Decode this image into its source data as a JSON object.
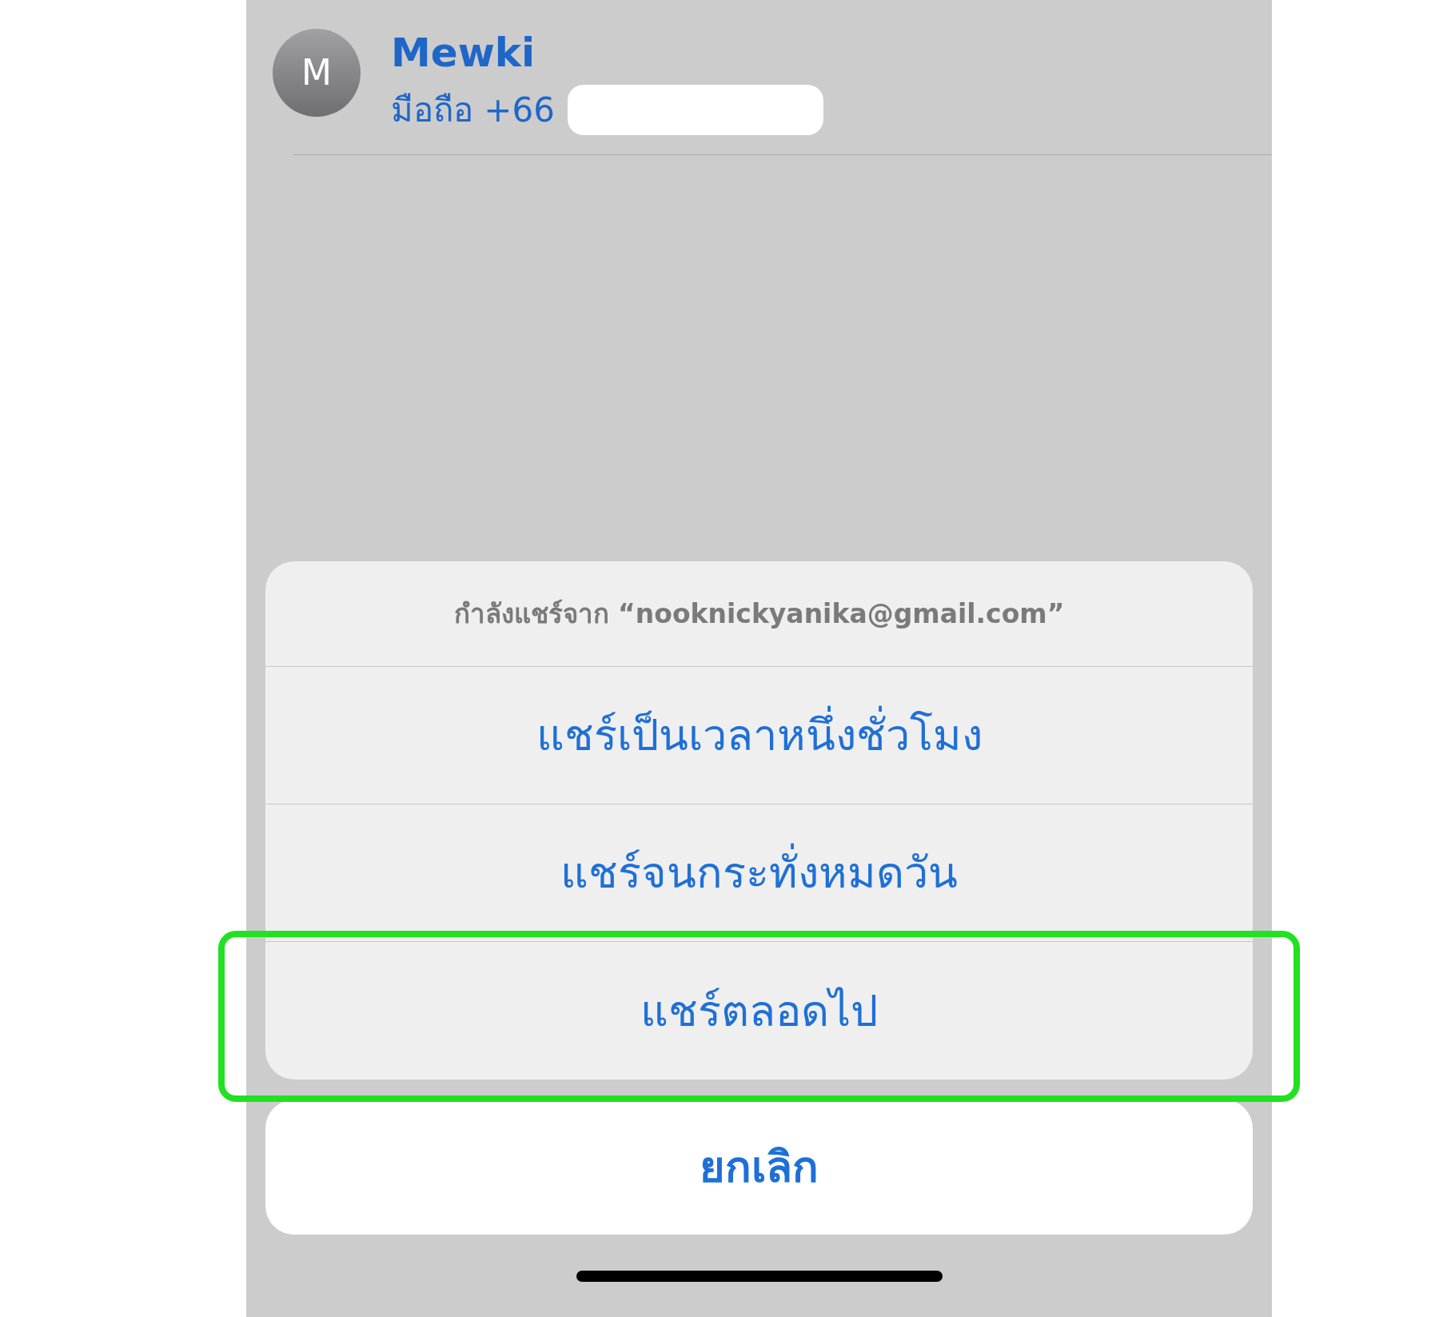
{
  "contact": {
    "avatar_initial": "M",
    "name": "Mewki",
    "phone_label": "มือถือ +66"
  },
  "action_sheet": {
    "header": "กำลังแชร์จาก “nooknickyanika@gmail.com”",
    "options": [
      {
        "label": "แชร์เป็นเวลาหนึ่งชั่วโมง",
        "highlighted": false
      },
      {
        "label": "แชร์จนกระทั่งหมดวัน",
        "highlighted": false
      },
      {
        "label": "แชร์ตลอดไป",
        "highlighted": true
      }
    ],
    "cancel": "ยกเลิก"
  }
}
